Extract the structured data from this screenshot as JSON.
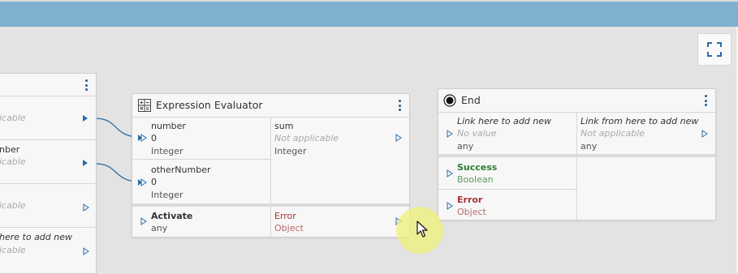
{
  "left_node": {
    "rows": [
      {
        "name": "",
        "sub": "icable"
      },
      {
        "name": "nber",
        "sub": "icable"
      },
      {
        "name": "",
        "sub": "icable"
      },
      {
        "name": "here to add new",
        "sub": "icable"
      }
    ]
  },
  "evaluator": {
    "title": "Expression Evaluator",
    "icon": "calculator-icon",
    "inputs": [
      {
        "name": "number",
        "value": "0",
        "type": "Integer"
      },
      {
        "name": "otherNumber",
        "value": "0",
        "type": "Integer"
      }
    ],
    "output": {
      "name": "sum",
      "value": "Not applicable",
      "type": "Integer"
    },
    "activate": {
      "name": "Activate",
      "type": "any"
    },
    "error": {
      "name": "Error",
      "type": "Object"
    }
  },
  "end_node": {
    "title": "End",
    "icon": "end-circle-icon",
    "link_in": {
      "name": "Link here to add new",
      "value": "No value",
      "type": "any"
    },
    "link_out": {
      "name": "Link from here to add new",
      "value": "Not applicable",
      "type": "any"
    },
    "success": {
      "name": "Success",
      "type": "Boolean"
    },
    "error": {
      "name": "Error",
      "type": "Object"
    }
  },
  "colors": {
    "accent": "#2a6aa8",
    "success": "#2e7d32",
    "error": "#a83232",
    "topbar": "#7fb0d0",
    "canvas": "#e3e3e3"
  }
}
